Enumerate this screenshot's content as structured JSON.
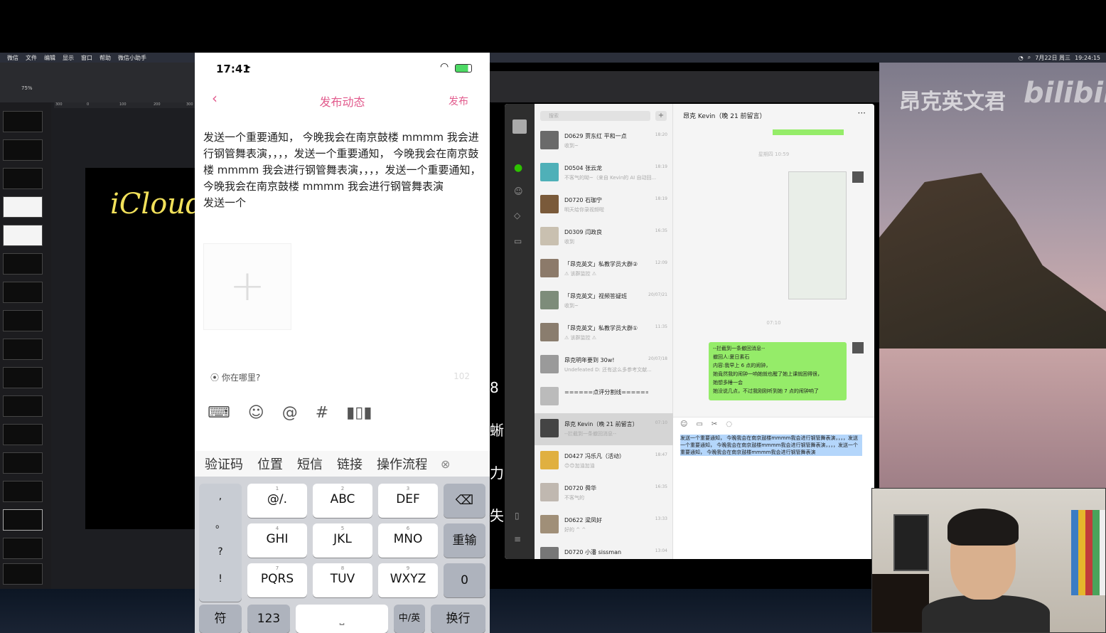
{
  "menubar": {
    "items": [
      "微信",
      "文件",
      "编辑",
      "显示",
      "窗口",
      "帮助",
      "微信小助手"
    ],
    "right": [
      "7月22日 周三",
      "19:24:15"
    ]
  },
  "keynote": {
    "zoom": "75%",
    "ruler": [
      "300",
      "0",
      "100",
      "200",
      "300"
    ],
    "canvas_text": "iCloud"
  },
  "phone": {
    "time": "17:41",
    "nav": {
      "back": "‹",
      "title": "发布动态",
      "publish": "发布"
    },
    "post_text": "发送一个重要通知， 今晚我会在南京鼓楼 mmmm 我会进行钢管舞表演，，，，发送一个重要通知， 今晚我会在南京鼓楼 mmmm 我会进行钢管舞表演，，，，发送一个重要通知， 今晚我会在南京鼓楼 mmmm 我会进行钢管舞表演\n发送一个",
    "add_image": "+",
    "location": "你在哪里?",
    "count": "102",
    "tools": [
      "keyboard-icon",
      "emoji-icon",
      "@",
      "#",
      "chart-icon"
    ],
    "quick_words": [
      "验证码",
      "位置",
      "短信",
      "链接",
      "操作流程"
    ],
    "keyboard": {
      "row1": [
        {
          "l": ",",
          "s": ""
        },
        {
          "l": "@/.",
          "s": "1"
        },
        {
          "l": "ABC",
          "s": "2"
        },
        {
          "l": "DEF",
          "s": "3"
        }
      ],
      "row2": [
        {
          "l": "GHI",
          "s": "4"
        },
        {
          "l": "JKL",
          "s": "5"
        },
        {
          "l": "MNO",
          "s": "6"
        }
      ],
      "row3": [
        {
          "l": "PQRS",
          "s": "7"
        },
        {
          "l": "TUV",
          "s": "8"
        },
        {
          "l": "WXYZ",
          "s": "9"
        }
      ],
      "left_col": [
        ",",
        "。",
        "?",
        "!"
      ],
      "retype": "重输",
      "zero": "0",
      "bottom": {
        "fu": "符",
        "num": "123",
        "cn": "中/英",
        "enter": "换行"
      }
    }
  },
  "overlap_text": [
    "8",
    "蜥",
    "力",
    "失"
  ],
  "wechat": {
    "search_placeholder": "搜索",
    "chats": [
      {
        "name": "D0629 贾东红 平和一点",
        "preview": "收到~",
        "time": "18:20"
      },
      {
        "name": "D0504 张云龙",
        "preview": "不客气的呦~（来自 Kevin的 AI 自动回...",
        "time": "18:19"
      },
      {
        "name": "D0720 石珈宁",
        "preview": "明天给你录视频啦",
        "time": "18:19"
      },
      {
        "name": "D0309 闫政良",
        "preview": "收到",
        "time": "16:35"
      },
      {
        "name": "「昂克英文」私教学员大群②",
        "preview": "⚠ 该群监控 ⚠",
        "time": "12:09"
      },
      {
        "name": "「昂克英文」视频答疑班",
        "preview": "收到~",
        "time": "20/07/21"
      },
      {
        "name": "「昂克英文」私教学员大群①",
        "preview": "⚠ 该群监控 ⚠",
        "time": "11:35"
      },
      {
        "name": "昂克明年要到 30w!",
        "preview": "Undefeated D: 还有这么多参考文献...",
        "time": "20/07/18"
      },
      {
        "name": "======点评分割线======",
        "preview": "",
        "time": ""
      },
      {
        "name": "昂克 Kevin（晚 21 前留言）",
        "preview": "--拦截到一条撤回消息--",
        "time": "07:10"
      },
      {
        "name": "D0427 冯乐凡（活动）",
        "preview": "😊😊加油加油",
        "time": "18:47"
      },
      {
        "name": "D0720 舜华",
        "preview": "不客气的",
        "time": "16:35"
      },
      {
        "name": "D0622 梁凤好",
        "preview": "好的 ^ ^",
        "time": "13:33"
      },
      {
        "name": "D0720 小潘 sissman",
        "preview": "",
        "time": "13:04"
      }
    ],
    "chat_title": "昂克 Kevin（晚 21 前留言）",
    "stamp1": "星期四 10:59",
    "stamp2": "07:10",
    "bubble_lines": [
      "--拦截到一条撤回消息--",
      "撤回人:夏日素石",
      "内容:我早上 6 点的闹钟，",
      "她竟然我的闹钟一响她就也醒了她上课就困得很，",
      "她想多睡一会",
      "她没说几点，不过我刚刚听到她 7 点的闹钟响了"
    ],
    "input_text": "发送一个重要通知， 今晚我会在南京鼓楼mmmm我会进行钢管舞表演，，，，发送一个重要通知， 今晚我会在南京鼓楼mmmm我会进行钢管舞表演，，，，发送一个重要通知， 今晚我会在南京鼓楼mmmm我会进行钢管舞表演"
  },
  "watermark": {
    "cn": "昂克英文君",
    "logo": "bilibili"
  }
}
